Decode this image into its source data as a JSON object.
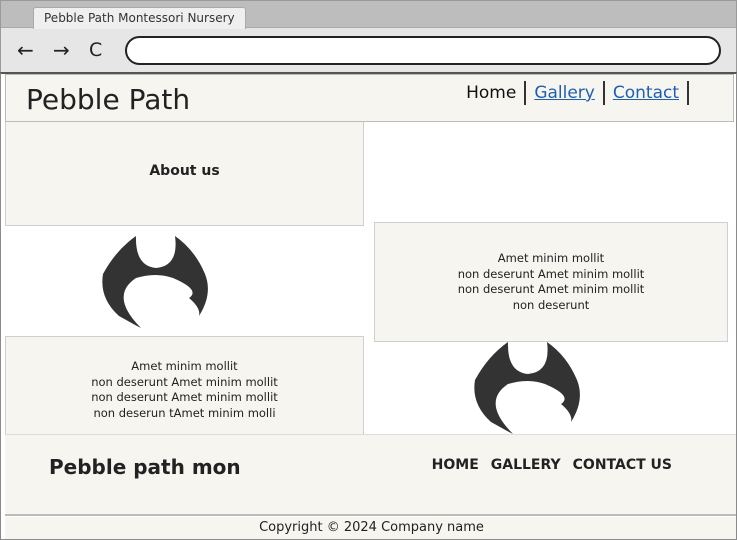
{
  "browser": {
    "tab_title": "Pebble Path Montessori Nursery",
    "back_icon": "←",
    "forward_icon": "→",
    "reload_icon": "C",
    "address_value": ""
  },
  "header": {
    "logo": "Pebble Path",
    "nav": [
      {
        "label": "Home",
        "active": true
      },
      {
        "label": "Gallery",
        "active": false
      },
      {
        "label": "Contact",
        "active": false
      }
    ]
  },
  "about": {
    "title": "About us"
  },
  "right_panel": {
    "lines": [
      "Amet minim mollit",
      "non deserunt Amet minim mollit",
      "non deserunt Amet minim mollit",
      "non deserunt"
    ]
  },
  "left_panel": {
    "lines": [
      "Amet minim mollit",
      "non deserunt Amet minim mollit",
      "non deserunt Amet minim mollit",
      "non deserun tAmet minim molli"
    ]
  },
  "footer": {
    "name": "Pebble path mon",
    "nav": [
      "HOME",
      "GALLERY",
      "CONTACT US"
    ],
    "copyright": "Copyright © 2024 Company name"
  },
  "colors": {
    "panel_bg": "#f7f5f0",
    "link": "#1f5fb0",
    "image_placeholder": "#333333"
  }
}
